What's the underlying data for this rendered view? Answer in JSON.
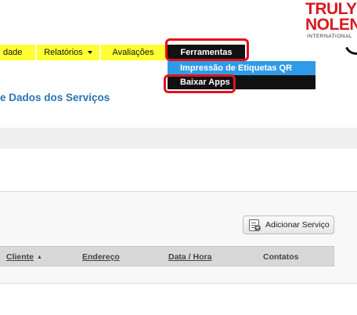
{
  "logo": {
    "line1": "TRULY",
    "line2": "NOLEN",
    "line3": "INTERNATIONAL"
  },
  "menu": {
    "items": [
      {
        "label": "dade"
      },
      {
        "label": "Relatórios",
        "has_dropdown": true
      },
      {
        "label": "Avaliações"
      },
      {
        "label": "Ferramentas"
      }
    ]
  },
  "dropdown": {
    "items": [
      {
        "label": "Impressão de Etiquetas QR"
      },
      {
        "label": "Baixar Apps"
      }
    ]
  },
  "page": {
    "title": "e Dados dos Serviços"
  },
  "toolbar": {
    "add_service_label": "Adicionar Serviço"
  },
  "table": {
    "columns": [
      {
        "label": "Cliente",
        "sorted": "asc",
        "arrow": "▲"
      },
      {
        "label": "Endereço"
      },
      {
        "label": "Data / Hora"
      },
      {
        "label": "Contatos"
      }
    ]
  },
  "colors": {
    "menu_yellow": "#ffff33",
    "menu_active": "#111111",
    "dropdown_highlight": "#2f9be8",
    "annotation_red": "#e3101a",
    "title_blue": "#2a73b0"
  }
}
